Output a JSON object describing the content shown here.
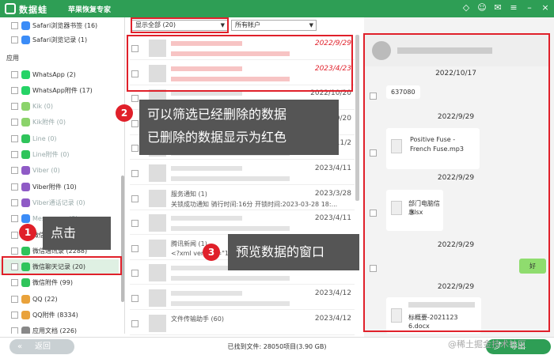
{
  "titlebar": {
    "app_name": "数据蛙",
    "subtitle": "苹果恢复专家"
  },
  "sidebar": {
    "items_top": [
      {
        "label": "Safari浏览器书签 (16)"
      },
      {
        "label": "Safari浏览记录 (1)"
      }
    ],
    "section_label": "应用",
    "items": [
      {
        "label": "WhatsApp (2)",
        "color": "#25d366"
      },
      {
        "label": "WhatsApp附件 (17)",
        "color": "#25d366"
      },
      {
        "label": "Kik (0)",
        "color": "#8bd36b"
      },
      {
        "label": "Kik附件 (0)",
        "color": "#8bd36b"
      },
      {
        "label": "Line (0)",
        "color": "#2fc45b"
      },
      {
        "label": "Line附件 (0)",
        "color": "#2fc45b"
      },
      {
        "label": "Viber (0)",
        "color": "#8f5bc6"
      },
      {
        "label": "Viber附件 (10)",
        "color": "#8f5bc6"
      },
      {
        "label": "Viber通话记录 (0)",
        "color": "#8f5bc6"
      },
      {
        "label": "Messenger (0)",
        "color": "#3b8cf7"
      },
      {
        "label": "微信",
        "color": "#2fc45b"
      },
      {
        "label": "微信通讯录 (2288)",
        "color": "#2fc45b"
      },
      {
        "label": "微信聊天记录 (20)",
        "color": "#2fc45b"
      },
      {
        "label": "微信附件 (99)",
        "color": "#2fc45b"
      },
      {
        "label": "QQ (22)",
        "color": "#e9a23b"
      },
      {
        "label": "QQ附件 (8334)",
        "color": "#e9a23b"
      },
      {
        "label": "应用文档 (226)",
        "color": "#888"
      }
    ]
  },
  "filters": {
    "show_all": "显示全部 (20)",
    "accounts": "所有帐户"
  },
  "search": {
    "placeholder": ""
  },
  "rows": [
    {
      "date": "2022/9/29",
      "title": "",
      "preview": "",
      "deleted": true
    },
    {
      "date": "2023/4/23",
      "title": "",
      "preview": "",
      "deleted": true
    },
    {
      "date": "2022/10/20",
      "title": "",
      "preview": "",
      "deleted": false
    },
    {
      "date": "2022/10/20",
      "title": "",
      "preview": "",
      "deleted": false
    },
    {
      "date": "2022/11/2",
      "title": "",
      "preview": "",
      "deleted": false
    },
    {
      "date": "2023/4/11",
      "title": "",
      "preview": "",
      "deleted": false
    },
    {
      "date": "2023/3/28",
      "title": "服务通知 (1)",
      "preview": "关锁成功通知 骑行时间:16分 开锁时间:2023-03-28 18:...",
      "deleted": false
    },
    {
      "date": "2023/4/11",
      "title": "",
      "preview": "",
      "deleted": false
    },
    {
      "date": "2023/4/12",
      "title": "腾讯新闻 (1)",
      "preview": "<?xml version=\"1.0\"?>",
      "deleted": false
    },
    {
      "date": "2023/4/12",
      "title": "",
      "preview": "",
      "deleted": false
    },
    {
      "date": "2023/4/12",
      "title": "",
      "preview": "",
      "deleted": false
    },
    {
      "date": "2023/4/12",
      "title": "文件传输助手 (60)",
      "preview": "",
      "deleted": false
    }
  ],
  "preview": {
    "d1": "2022/10/17",
    "msg1": "637080",
    "d2": "2022/9/29",
    "file1_line1": "Positive Fuse -",
    "file1_line2": "French Fuse.mp3",
    "d3": "2022/9/29",
    "file2_line1": "部门电脑信息",
    "file2_line2": ".xlsx",
    "d4": "2022/9/29",
    "sent": "好",
    "d5": "2022/9/29",
    "last": "标概要-2021123",
    "last2": "6.docx"
  },
  "bottom": {
    "back": "返回",
    "status": "已找到文件: 28050项目(3.90 GB)",
    "export": "导出"
  },
  "annotations": {
    "n1": "1",
    "c1": "点击",
    "n2": "2",
    "c2a": "可以筛选已经删除的数据",
    "c2b": "已删除的数据显示为红色",
    "n3": "3",
    "c3": "预览数据的窗口"
  },
  "watermark": "@稀土掘金技术社区",
  "colors": {
    "green": "#2e9e55",
    "red": "#e0202a",
    "deleted_text": "#f4a3a3"
  }
}
